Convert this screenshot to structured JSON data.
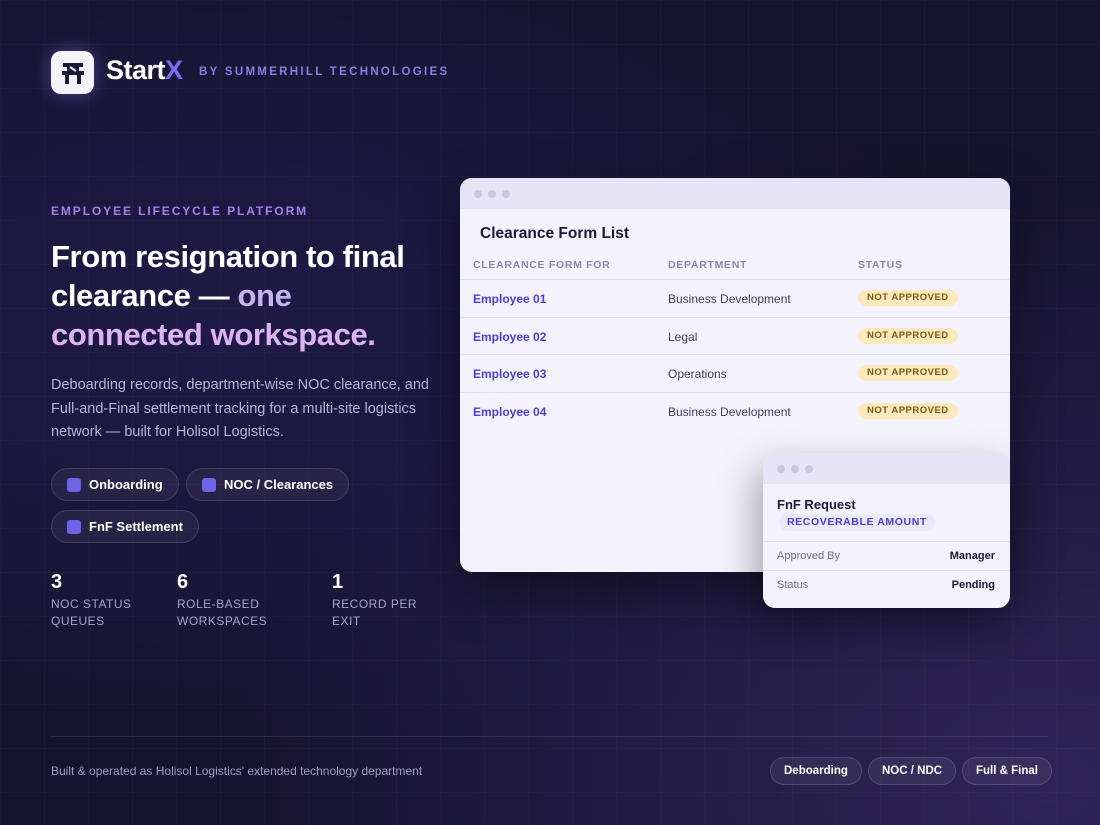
{
  "header": {
    "brand_main": "Start",
    "brand_x": "X",
    "brand_sub": "BY SUMMERHILL TECHNOLOGIES",
    "logo_icon": "chair-icon"
  },
  "hero": {
    "eyebrow": "EMPLOYEE LIFECYCLE PLATFORM",
    "headline_part1": "From resignation to final clearance —",
    "headline_part2": "one",
    "headline_part3": "connected workspace.",
    "description": "Deboarding records, department-wise NOC clearance, and Full-and-Final settlement tracking for a multi-site logistics network — built for Holisol Logistics.",
    "chips": [
      "Onboarding",
      "NOC / Clearances",
      "FnF Settlement"
    ],
    "stats": [
      {
        "num": "3",
        "label": "NOC STATUS QUEUES"
      },
      {
        "num": "6",
        "label": "ROLE-BASED WORKSPACES"
      },
      {
        "num": "1",
        "label": "RECORD PER EXIT"
      }
    ]
  },
  "clearance": {
    "title": "Clearance Form List",
    "columns": [
      "CLEARANCE FORM FOR",
      "DEPARTMENT",
      "STATUS"
    ],
    "rows": [
      {
        "employee": "Employee 01",
        "department": "Business Development",
        "status": "NOT APPROVED"
      },
      {
        "employee": "Employee 02",
        "department": "Legal",
        "status": "NOT APPROVED"
      },
      {
        "employee": "Employee 03",
        "department": "Operations",
        "status": "NOT APPROVED"
      },
      {
        "employee": "Employee 04",
        "department": "Business Development",
        "status": "NOT APPROVED"
      }
    ]
  },
  "fnf": {
    "title": "FnF Request",
    "badge": "RECOVERABLE AMOUNT",
    "fields": [
      {
        "key": "Approved By",
        "value": "Manager"
      },
      {
        "key": "Status",
        "value": "Pending"
      }
    ]
  },
  "footer": {
    "text": "Built & operated as Holisol Logistics' extended technology department",
    "chips": [
      "Deboarding",
      "NOC / NDC",
      "Full & Final"
    ]
  },
  "colors": {
    "accent": "#6b63e8",
    "badge_warning_bg": "#fbe9bd",
    "link": "#4a3fd0"
  }
}
